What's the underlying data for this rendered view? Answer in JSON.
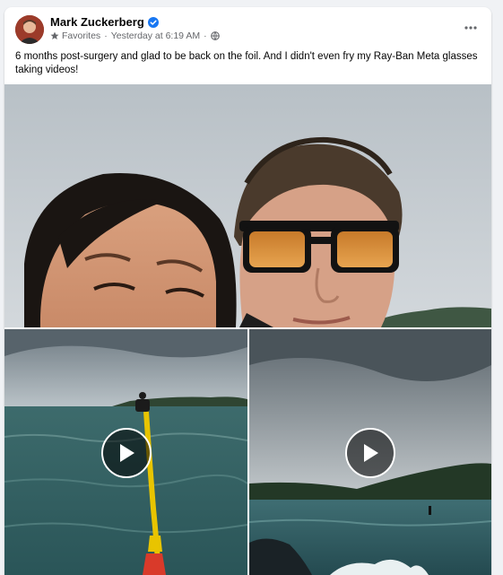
{
  "post": {
    "author": "Mark Zuckerberg",
    "audience": "Favorites",
    "timestamp": "Yesterday at 6:19 AM",
    "separator": "·",
    "text": "6 months post-surgery and glad to be back on the foil. And I didn't even fry my Ray-Ban Meta glasses taking videos!"
  },
  "icons": {
    "verified": "verified-badge-icon",
    "favorites": "star-icon",
    "privacy": "globe-icon",
    "more": "more-options-icon",
    "play": "play-icon"
  },
  "colors": {
    "verified": "#1877f2",
    "meta_text": "#65676b",
    "background": "#f0f2f5"
  }
}
